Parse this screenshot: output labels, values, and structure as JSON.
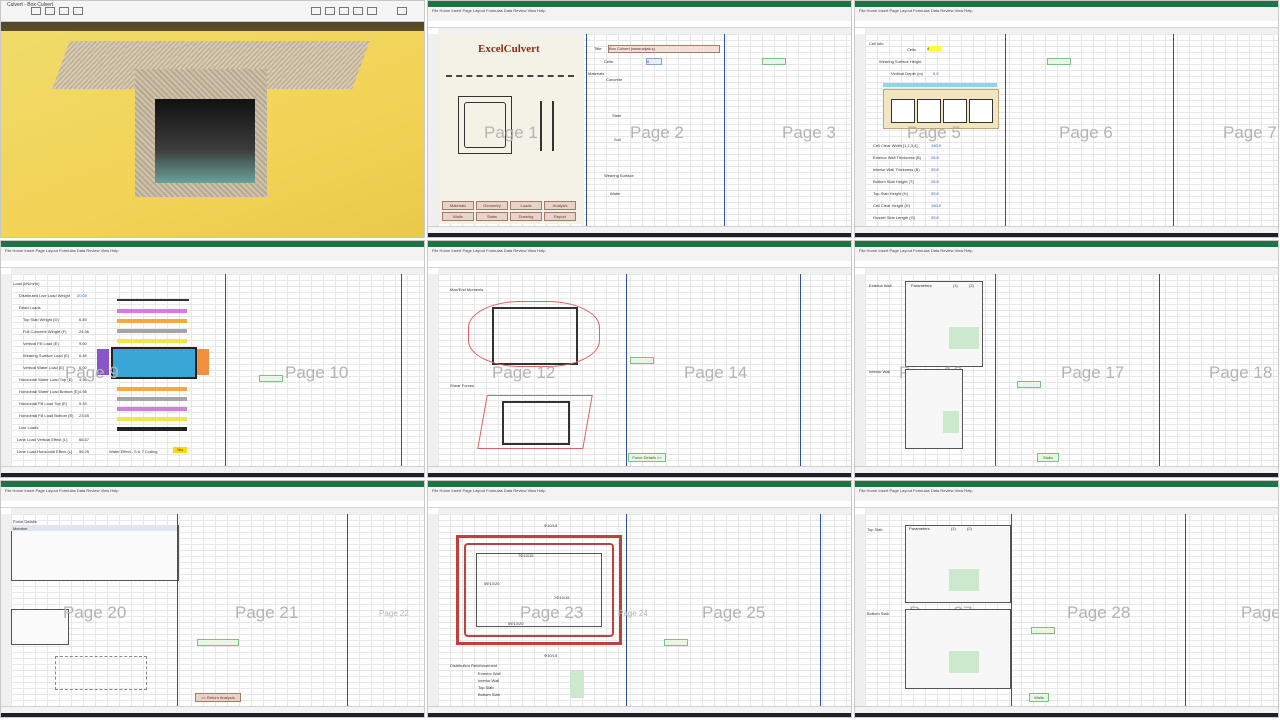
{
  "render_window": {
    "title": "Culvert - Box Culvert"
  },
  "excel": {
    "ribbon_tabs": "File  Home  Insert  Page Layout  Formulas  Data  Review  View  Help"
  },
  "panel2": {
    "app_title": "ExcelCulvert",
    "title_label": "Title:",
    "title_value": "Box Culvert (www.wijak.s)",
    "cells_label": "Cells:",
    "cells_value": "0",
    "materials_label": "Materials",
    "concrete_label": "Concrete",
    "steel_label": "Steel",
    "soil_label": "Soil",
    "wearing_label": "Wearing Surface",
    "water_label": "Water",
    "buttons": [
      "Materials",
      "Geometry",
      "Loads",
      "Analysis",
      "Walls",
      "Slabs",
      "Drawing",
      "Report"
    ],
    "page1": "Page 1",
    "page2": "Page 2",
    "page3": "Page 3"
  },
  "panel3": {
    "header": "Cell info",
    "cells_label": "Cells",
    "cells_value": "4",
    "wearing_label": "Wearing Surface Height",
    "vertical_label": "Vertical Depth (m)",
    "vertical_value": "0.0",
    "rows": [
      {
        "label": "Cell Clear Width [1,2,3,4]",
        "value": "150.0"
      },
      {
        "label": "Exterior Wall Thickness (B)",
        "value": "25.0"
      },
      {
        "label": "Interior Wall Thickness (B)",
        "value": "25.0"
      },
      {
        "label": "Bottom Slab Height (T)",
        "value": "25.0"
      },
      {
        "label": "Top Slab Height (H)",
        "value": "25.0"
      },
      {
        "label": "Cell Clear Height (H)",
        "value": "150.0"
      },
      {
        "label": "Gusset Side Length (G)",
        "value": "25.0"
      }
    ],
    "page5": "Page 5",
    "page6": "Page 6",
    "page7": "Page 7"
  },
  "panel4": {
    "header": "Load (kN/m/m)",
    "rows": [
      {
        "label": "Distributed Live Load Weight",
        "value": "20.00"
      },
      {
        "label": "Dead Loads",
        "value": ""
      },
      {
        "label": "Top Slab Weight (D)",
        "value": "6.49"
      },
      {
        "label": "Full Concrete Weight (F)",
        "value": "24.96"
      },
      {
        "label": "Vertical Fill Load (E)",
        "value": "9.00"
      },
      {
        "label": "Wearing Surface Load (E)",
        "value": "6.48"
      },
      {
        "label": "Vertical Water Load (E)",
        "value": "0.00"
      },
      {
        "label": "Horizontal Water Load Top (E)",
        "value": "4.98"
      },
      {
        "label": "Horizontal Water Load Bottom (E)",
        "value": "4.98"
      },
      {
        "label": "Horizontal Fill Load Top (E)",
        "value": "5.33"
      },
      {
        "label": "Horizontal Fill Load Bottom (E)",
        "value": "23.65"
      },
      {
        "label": "Live Loads",
        "value": ""
      },
      {
        "label": "Lane Load Vertical Effect (L)",
        "value": "66.67"
      },
      {
        "label": "Lane Load Horizontal Effect (L)",
        "value": "56.25"
      }
    ],
    "water_effect_label": "Water Effect - 5 & 7 Coding",
    "water_effect_value": "Yes",
    "page9": "Page 9",
    "page10": "Page 10"
  },
  "panel5": {
    "moments_label": "Max/End Moments",
    "shear_label": "Shear Forces",
    "page12": "Page 12",
    "page14": "Page 14",
    "link": "Force Details >>"
  },
  "panel6": {
    "exterior_label": "Exterior Wall",
    "interior_label": "Interior Wall",
    "col_headers": [
      "Parameters",
      "(1)",
      "(2)"
    ],
    "page16": "Page 16",
    "page17": "Page 17",
    "page18": "Page 18",
    "link": "Slabs"
  },
  "panel7": {
    "header": "Force Details",
    "col_headers": [
      "Member",
      "1",
      "2",
      "3",
      "4",
      "5",
      "6",
      "7",
      "8",
      "9",
      "10"
    ],
    "page20": "Page 20",
    "page21": "Page 21",
    "page22": "Page 22",
    "link": "<< Return Analysis"
  },
  "panel8": {
    "dim_top": "Φ10/15",
    "dim_bottom": "Φ10/15",
    "rebar_labels": [
      "7Φ10/15",
      "5Φ10/20",
      "7Φ10/15",
      "5Φ10/20"
    ],
    "dist_label": "Distribution Reinforcement",
    "dist_rows": [
      "Exterior Wall",
      "Interior Wall",
      "Top Slab",
      "Bottom Slab"
    ],
    "page23": "Page 23",
    "page24": "Page 24",
    "page25": "Page 25"
  },
  "panel9": {
    "top_label": "Top Slab",
    "bottom_label": "Bottom Slab",
    "col_headers": [
      "Parameters",
      "(1)",
      "(2)"
    ],
    "page27": "Page 27",
    "page28": "Page 28",
    "page29": "Page",
    "link": "Walls"
  },
  "colors": {
    "excel_green": "#217346",
    "page_label": "#b4b4b4",
    "accent_red": "#d04040",
    "app_title": "#8b2c1a"
  }
}
